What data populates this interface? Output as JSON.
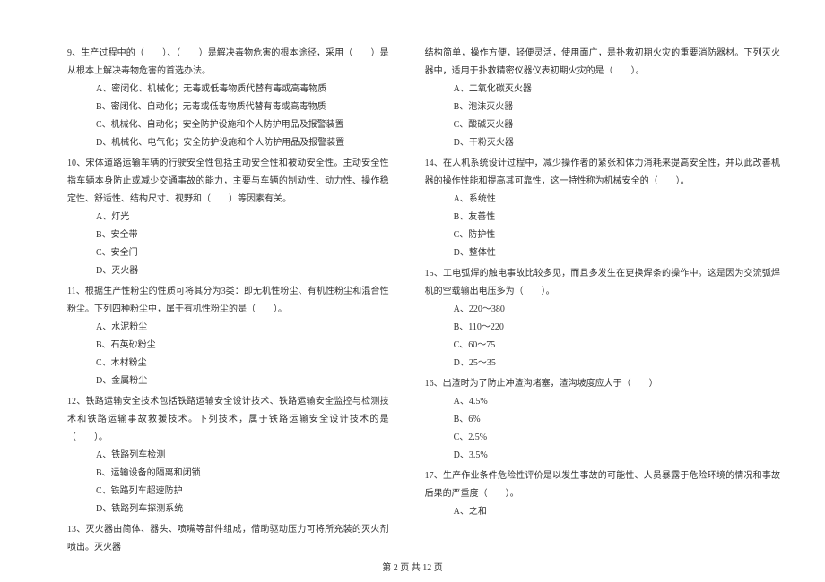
{
  "left_column": {
    "q9": {
      "text": "9、生产过程中的（　　）、（　　）是解决毒物危害的根本途径，采用（　　）是从根本上解决毒物危害的首选办法。",
      "options": {
        "a": "A、密闭化、机械化；无毒或低毒物质代替有毒或高毒物质",
        "b": "B、密闭化、自动化；无毒或低毒物质代替有毒或高毒物质",
        "c": "C、机械化、自动化；安全防护设施和个人防护用品及报警装置",
        "d": "D、机械化、电气化；安全防护设施和个人防护用品及报警装置"
      }
    },
    "q10": {
      "text": "10、宋体道路运输车辆的行驶安全性包括主动安全性和被动安全性。主动安全性指车辆本身防止或减少交通事故的能力，主要与车辆的制动性、动力性、操作稳定性、舒适性、结构尺寸、视野和（　　）等因素有关。",
      "options": {
        "a": "A、灯光",
        "b": "B、安全带",
        "c": "C、安全门",
        "d": "D、灭火器"
      }
    },
    "q11": {
      "text": "11、根据生产性粉尘的性质可将其分为3类：即无机性粉尘、有机性粉尘和混合性粉尘。下列四种粉尘中，属于有机性粉尘的是（　　）。",
      "options": {
        "a": "A、水泥粉尘",
        "b": "B、石英砂粉尘",
        "c": "C、木材粉尘",
        "d": "D、金属粉尘"
      }
    },
    "q12": {
      "text": "12、铁路运输安全技术包括铁路运输安全设计技术、铁路运输安全监控与检测技术和铁路运输事故救援技术。下列技术，属于铁路运输安全设计技术的是（　　）。",
      "options": {
        "a": "A、铁路列车检测",
        "b": "B、运输设备的隔离和闭锁",
        "c": "C、铁路列车超速防护",
        "d": "D、铁路列车探测系统"
      }
    },
    "q13": {
      "text": "13、灭火器由简体、器头、喷嘴等部件组成，借助驱动压力可将所充装的灭火剂喷出。灭火器"
    }
  },
  "right_column": {
    "q13_cont": {
      "text": "结构简单，操作方便，轻便灵活，使用面广，是扑救初期火灾的重要消防器材。下列灭火器中，适用于扑救精密仪器仪表初期火灾的是（　　）。",
      "options": {
        "a": "A、二氧化碳灭火器",
        "b": "B、泡沫灭火器",
        "c": "C、酸碱灭火器",
        "d": "D、干粉灭火器"
      }
    },
    "q14": {
      "text": "14、在人机系统设计过程中，减少操作者的紧张和体力消耗来提高安全性，并以此改善机器的操作性能和提高其可靠性，这一特性称为机械安全的（　　）。",
      "options": {
        "a": "A、系统性",
        "b": "B、友善性",
        "c": "C、防护性",
        "d": "D、整体性"
      }
    },
    "q15": {
      "text": "15、工电弧焊的触电事故比较多见，而且多发生在更换焊条的操作中。这是因为交流弧焊机的空载输出电压多为（　　）。",
      "options": {
        "a": "A、220～380",
        "b": "B、110～220",
        "c": "C、60～75",
        "d": "D、25～35"
      }
    },
    "q16": {
      "text": "16、出渣时为了防止冲渣沟堵塞，渣沟坡度应大于（　　）",
      "options": {
        "a": "A、4.5%",
        "b": "B、6%",
        "c": "C、2.5%",
        "d": "D、3.5%"
      }
    },
    "q17": {
      "text": "17、生产作业条件危险性评价是以发生事故的可能性、人员暴露于危险环境的情况和事故后果的严重度（　　）。",
      "options": {
        "a": "A、之和"
      }
    }
  },
  "footer": "第 2 页 共 12 页"
}
